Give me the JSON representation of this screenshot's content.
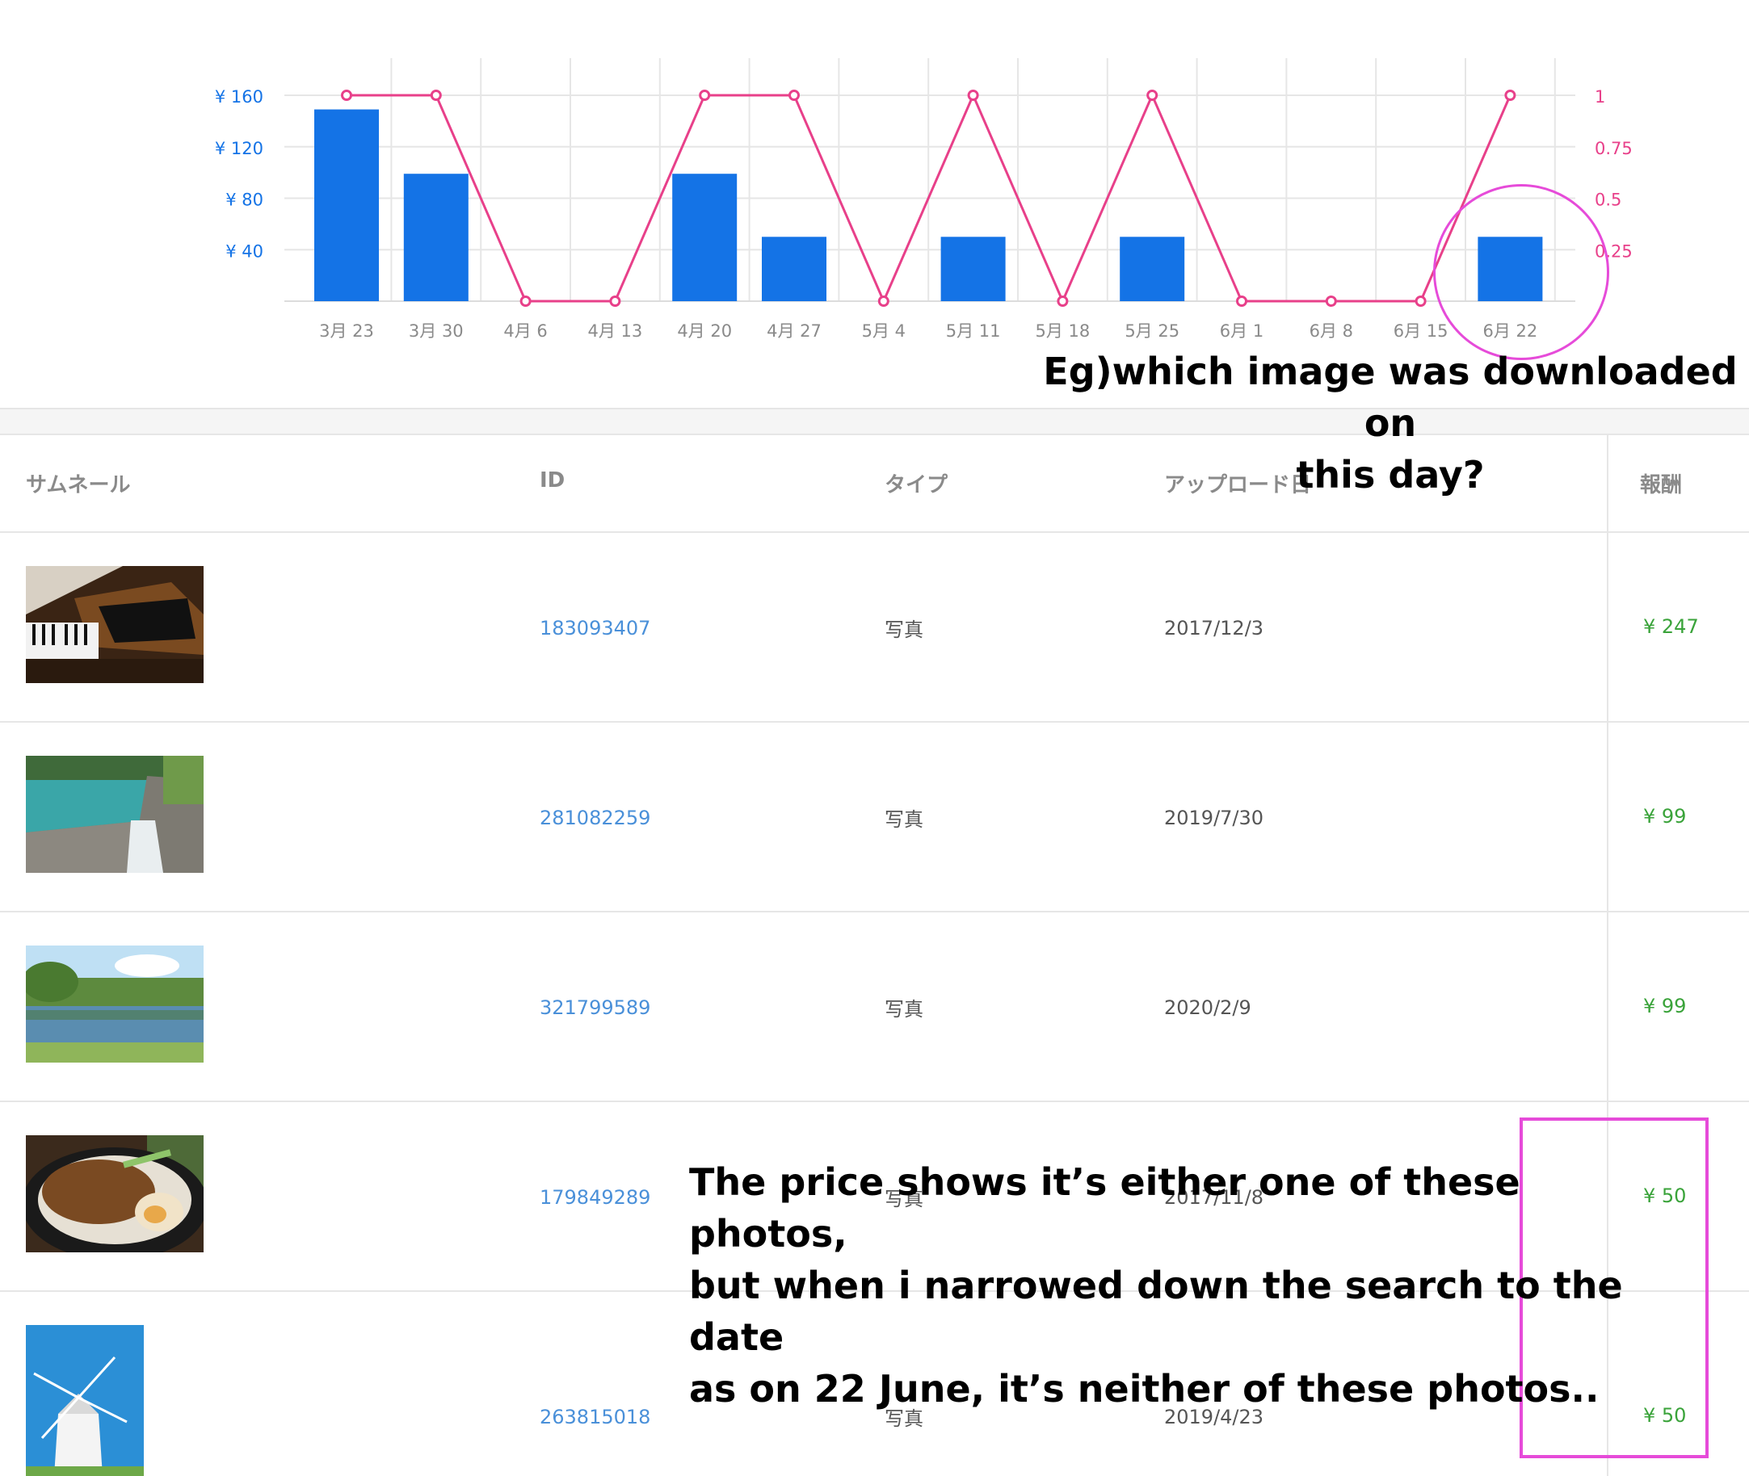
{
  "chart_data": {
    "type": "bar",
    "categories": [
      "3月 23",
      "3月 30",
      "4月 6",
      "4月 13",
      "4月 20",
      "4月 27",
      "5月 4",
      "5月 11",
      "5月 18",
      "5月 25",
      "6月 1",
      "6月 8",
      "6月 15",
      "6月 22"
    ],
    "series": [
      {
        "axis": "left",
        "kind": "bar",
        "color": "#1473e6",
        "values": [
          149,
          99,
          0,
          0,
          99,
          50,
          0,
          50,
          0,
          50,
          0,
          0,
          0,
          50
        ]
      },
      {
        "axis": "right",
        "kind": "line",
        "color": "#e8408a",
        "values": [
          1,
          1,
          0,
          0,
          1,
          1,
          0,
          1,
          0,
          1,
          0,
          0,
          0,
          1
        ]
      }
    ],
    "y_left": {
      "ticks": [
        40,
        80,
        120,
        160
      ],
      "tick_labels": [
        "¥ 40",
        "¥ 80",
        "¥ 120",
        "¥ 160"
      ],
      "range": [
        0,
        160
      ],
      "color": "#1473e6"
    },
    "y_right": {
      "ticks": [
        0.25,
        0.5,
        0.75,
        1
      ],
      "tick_labels": [
        "0.25",
        "0.5",
        "0.75",
        "1"
      ],
      "range": [
        0,
        1
      ],
      "color": "#e8408a"
    },
    "grid": true
  },
  "table": {
    "headers": {
      "thumbnail": "サムネール",
      "id": "ID",
      "type": "タイプ",
      "upload_date": "アップロード日",
      "reward": "報酬"
    },
    "rows": [
      {
        "thumb": "piano",
        "id": "183093407",
        "type": "写真",
        "date": "2017/12/3",
        "reward": "¥ 247"
      },
      {
        "thumb": "dam",
        "id": "281082259",
        "type": "写真",
        "date": "2019/7/30",
        "reward": "¥ 99"
      },
      {
        "thumb": "lake",
        "id": "321799589",
        "type": "写真",
        "date": "2020/2/9",
        "reward": "¥ 99"
      },
      {
        "thumb": "food-bowl",
        "id": "179849289",
        "type": "写真",
        "date": "2017/11/8",
        "reward": "¥ 50"
      },
      {
        "thumb": "windmill",
        "id": "263815018",
        "type": "写真",
        "date": "2019/4/23",
        "reward": "¥ 50"
      }
    ]
  },
  "annotations": {
    "question": "Eg)which image was downloaded on\nthis day?",
    "explanation": "The price shows it’s either one of these photos,\nbut when i narrowed down the search to the date\nas on 22 June, it’s neither of these photos..",
    "color": "#e64bd9"
  }
}
